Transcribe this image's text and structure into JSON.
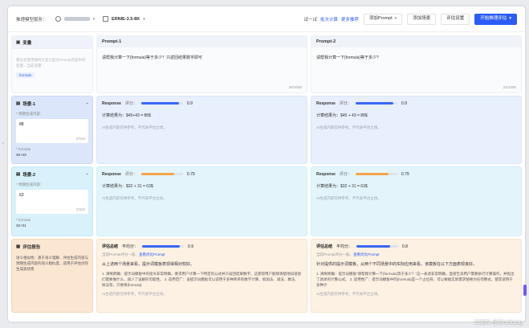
{
  "topbar": {
    "service_label": "推理模型服务：",
    "model_name": "ERNIE-3.5-8K",
    "try_label": "试一试",
    "link1": "批次计算",
    "link2": "更多推荐",
    "add_prompt": "添加Prompt",
    "add_scene": "添加场景",
    "eval_settings": "评估设置",
    "start_eval": "开始推理评估"
  },
  "variables": {
    "title": "变量",
    "placeholder": "建议变量用随时大变引起文Prompt内容中的变量，当前变量：",
    "tag": "formula"
  },
  "prompts": [
    {
      "title": "Prompt-1",
      "text": "请帮我计算一下{formula}等于多少？只返回结果数字即可",
      "count": "30/1000"
    },
    {
      "title": "Prompt-2",
      "text": "请帮我计算一下{formula}等于多少?",
      "count": "21/1000"
    }
  ],
  "scenes": [
    {
      "title": "场景-1",
      "field_label": "* 预期生成内容：",
      "value": "88",
      "count": "2/500",
      "formula_label": "* formula",
      "formula_value": "45+43",
      "responses": [
        {
          "label": "Response",
          "score_label": "评分：",
          "score": "0.9",
          "fill": 0.9,
          "color": "#3a66f5",
          "text": "计算结果为：$45+43 = 88$",
          "note": "AI生成内容仅供参考，不代表平台立场。"
        },
        {
          "label": "Response",
          "score_label": "评分：",
          "score": "0.9",
          "fill": 0.9,
          "color": "#3a66f5",
          "text": "计算结果为：$45 + 43 = 88$",
          "note": "AI生成内容仅供参考，不代表平台立场。"
        }
      ]
    },
    {
      "title": "场景-2",
      "field_label": "* 预期生成内容：",
      "value": "63",
      "count": "2/500",
      "formula_label": "* formula",
      "formula_value": "32+31",
      "responses": [
        {
          "label": "Response",
          "score_label": "评分：",
          "score": "0.79",
          "fill": 0.79,
          "color": "#f5a54a",
          "text": "计算结果为：$32 + 31 = 63$",
          "note": "AI生成内容仅供参考，不代表平台立场。"
        },
        {
          "label": "Response",
          "score_label": "评分：",
          "score": "0.79",
          "fill": 0.79,
          "color": "#f5a54a",
          "text": "计算结果为：$32 + 31 = 63$",
          "note": "AI生成内容仅供参考，不代表平台立场。"
        }
      ]
    }
  ],
  "evaluation": {
    "title": "评估报告",
    "desc": "语义相似性：基于语义理解、评估生成内容与预期生成内容的语义相似度，适用于评估创作生成类场景",
    "reports": [
      {
        "label": "评估总结",
        "avg_label": "平均分：",
        "score": "0.9",
        "fill": 0.9,
        "line": "当前Prompt评分一般，",
        "link": "查看优化Prompt",
        "title": "从上述两个场景来看，提示词模板表现得相对较好。",
        "body": "1. 清晰明确：提示词模板中的指令非常明确，要求用户计算一下特定的公式并只返回结果数字。这使得用户能够清楚地知道他们需要做什么，减少了误解的可能性。 2. 适用范广：该提示词模板可以适用于多种简单的数学计算，如加法、减法、乘法、除法等，只要将{formula}",
        "note": "AI生成内容仅供参考，不代表平台立场。"
      },
      {
        "label": "评估总结",
        "avg_label": "平均分：",
        "score": "0.8",
        "fill": 0.8,
        "line": "当前Prompt评分一般，",
        "link": "查看优化Prompt",
        "title": "针对提供的提示词模板，从两个不同场景中的实际应用来看，该模板在以下方面表现良好。",
        "body": "1. 清晰明确：提示词模板“请帮我计算一下{formula}等于多少？”这一表述非常明确，直接告诉用户需要执行计算操作，并指出了具体的计算公式。 2. 适用性广：提示词模板中的{formula}是一个占位符，可以根据实际需求替换为任何算式，使其适用于多种计",
        "note": "AI生成内容仅供参考，不代表平台立场。"
      }
    ]
  },
  "watermark": "CSDN @Shockang"
}
